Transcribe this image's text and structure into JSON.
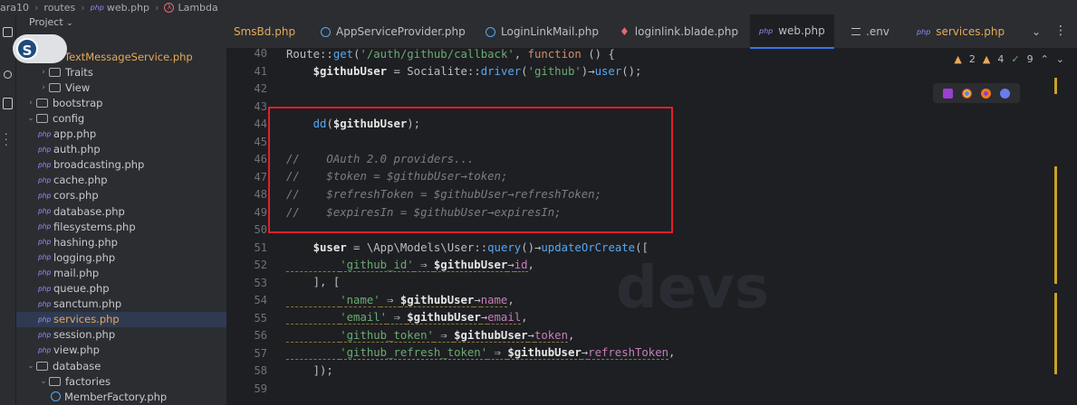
{
  "breadcrumb": {
    "project": "ara10",
    "folder": "routes",
    "file": "web.php",
    "symbol": "Lambda"
  },
  "tree": {
    "header": "Project",
    "items": [
      {
        "label": "TextMessageService.php",
        "kind": "class-orange",
        "indent": 3
      },
      {
        "label": "Traits",
        "kind": "folder",
        "indent": 2
      },
      {
        "label": "View",
        "kind": "folder",
        "indent": 2
      },
      {
        "label": "bootstrap",
        "kind": "folder",
        "indent": 1
      },
      {
        "label": "config",
        "kind": "folder-open",
        "indent": 1
      },
      {
        "label": "app.php",
        "kind": "php",
        "indent": 2
      },
      {
        "label": "auth.php",
        "kind": "php",
        "indent": 2
      },
      {
        "label": "broadcasting.php",
        "kind": "php",
        "indent": 2
      },
      {
        "label": "cache.php",
        "kind": "php",
        "indent": 2
      },
      {
        "label": "cors.php",
        "kind": "php",
        "indent": 2
      },
      {
        "label": "database.php",
        "kind": "php",
        "indent": 2
      },
      {
        "label": "filesystems.php",
        "kind": "php",
        "indent": 2
      },
      {
        "label": "hashing.php",
        "kind": "php",
        "indent": 2
      },
      {
        "label": "logging.php",
        "kind": "php",
        "indent": 2
      },
      {
        "label": "mail.php",
        "kind": "php",
        "indent": 2
      },
      {
        "label": "queue.php",
        "kind": "php",
        "indent": 2
      },
      {
        "label": "sanctum.php",
        "kind": "php",
        "indent": 2
      },
      {
        "label": "services.php",
        "kind": "php",
        "indent": 2,
        "selected": true
      },
      {
        "label": "session.php",
        "kind": "php",
        "indent": 2
      },
      {
        "label": "view.php",
        "kind": "php",
        "indent": 2
      },
      {
        "label": "database",
        "kind": "folder-open",
        "indent": 1
      },
      {
        "label": "factories",
        "kind": "folder-open",
        "indent": 2
      },
      {
        "label": "MemberFactory.php",
        "kind": "class",
        "indent": 3
      }
    ]
  },
  "badge": {
    "letter": "S"
  },
  "tabs": [
    {
      "label": "SmsBd.php",
      "icon": "none",
      "color": "orange"
    },
    {
      "label": "AppServiceProvider.php",
      "icon": "class"
    },
    {
      "label": "LoginLinkMail.php",
      "icon": "class"
    },
    {
      "label": "loginlink.blade.php",
      "icon": "blade"
    },
    {
      "label": "web.php",
      "icon": "php",
      "active": true
    },
    {
      "label": ".env",
      "icon": "env"
    },
    {
      "label": "services.php",
      "icon": "php",
      "color": "orange"
    }
  ],
  "inspections": {
    "warnings": "2",
    "weak": "4",
    "checks": "9"
  },
  "editor": {
    "line_numbers": [
      "40",
      "41",
      "42",
      "43",
      "44",
      "45",
      "46",
      "47",
      "48",
      "49",
      "50",
      "51",
      "52",
      "53",
      "54",
      "55",
      "56",
      "57",
      "58",
      "59"
    ],
    "line40": {
      "route": "Route",
      "get": "get",
      "path": "'/auth/github/callback'",
      "function": "function",
      "tail": " () {"
    },
    "line41": {
      "var": "$githubUser",
      "socialite": "Socialite",
      "driver": "driver",
      "arg": "'github'",
      "user": "user"
    },
    "line44": {
      "dd": "dd",
      "var": "$githubUser"
    },
    "line46": {
      "comment": "OAuth 2.0 providers..."
    },
    "line47": {
      "lhs": "$token",
      "rhs": "$githubUser",
      "prop": "token"
    },
    "line48": {
      "lhs": "$refreshToken",
      "rhs": "$githubUser",
      "prop": "refreshToken"
    },
    "line49": {
      "lhs": "$expiresIn",
      "rhs": "$githubUser",
      "prop": "expiresIn"
    },
    "line51": {
      "var": "$user",
      "ns": "\\App\\Models\\User",
      "query": "query",
      "method": "updateOrCreate"
    },
    "line52": {
      "key": "'github_id'",
      "var": "$githubUser",
      "prop": "id"
    },
    "line54": {
      "key": "'name'",
      "var": "$githubUser",
      "prop": "name"
    },
    "line55": {
      "key": "'email'",
      "var": "$githubUser",
      "prop": "email"
    },
    "line56": {
      "key": "'github_token'",
      "var": "$githubUser",
      "prop": "token"
    },
    "line57": {
      "key": "'github_refresh_token'",
      "var": "$githubUser",
      "prop": "refreshToken"
    }
  },
  "colors": {
    "highlight_box": "#e0202a",
    "accent": "#3574f0"
  }
}
